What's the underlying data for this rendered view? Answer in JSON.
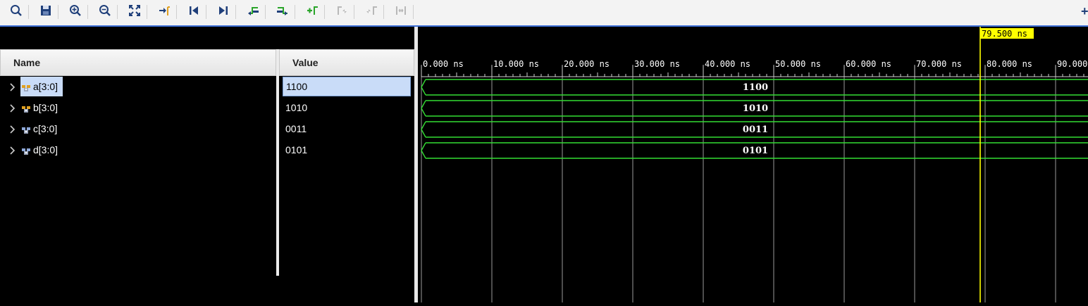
{
  "toolbar": {
    "buttons": [
      {
        "name": "search-icon",
        "glyph": "search"
      },
      {
        "name": "save-icon",
        "glyph": "save"
      },
      {
        "name": "zoom-in-icon",
        "glyph": "zoom-in"
      },
      {
        "name": "zoom-out-icon",
        "glyph": "zoom-out"
      },
      {
        "name": "zoom-fit-icon",
        "glyph": "fit"
      },
      {
        "name": "go-to-cursor-icon",
        "glyph": "cursor"
      },
      {
        "name": "go-to-time-zero-icon",
        "glyph": "first"
      },
      {
        "name": "go-to-last-time-icon",
        "glyph": "last"
      },
      {
        "name": "previous-transition-icon",
        "glyph": "prev"
      },
      {
        "name": "next-transition-icon",
        "glyph": "next"
      },
      {
        "name": "add-marker-icon",
        "glyph": "add"
      },
      {
        "name": "previous-marker-icon",
        "glyph": "prevm"
      },
      {
        "name": "next-marker-icon",
        "glyph": "nextm"
      },
      {
        "name": "swap-cursors-icon",
        "glyph": "swap"
      }
    ],
    "overflow": "+"
  },
  "columns": {
    "name": "Name",
    "value": "Value"
  },
  "signals": [
    {
      "name": "a[3:0]",
      "value": "1100",
      "selected": true
    },
    {
      "name": "b[3:0]",
      "value": "1010",
      "selected": false
    },
    {
      "name": "c[3:0]",
      "value": "0011",
      "selected": false
    },
    {
      "name": "d[3:0]",
      "value": "0101",
      "selected": false
    }
  ],
  "timeline": {
    "ticks": [
      "0.000 ns",
      "10.000 ns",
      "20.000 ns",
      "30.000 ns",
      "40.000 ns",
      "50.000 ns",
      "60.000 ns",
      "70.000 ns",
      "80.000 ns",
      "90.000"
    ],
    "cursor_label": "79.500 ns",
    "cursor_time": 79.5
  },
  "colors": {
    "wave": "#33dd33",
    "cursor": "#ffff00",
    "grid": "#d0d0d0",
    "selection": "#c9dcf8"
  }
}
